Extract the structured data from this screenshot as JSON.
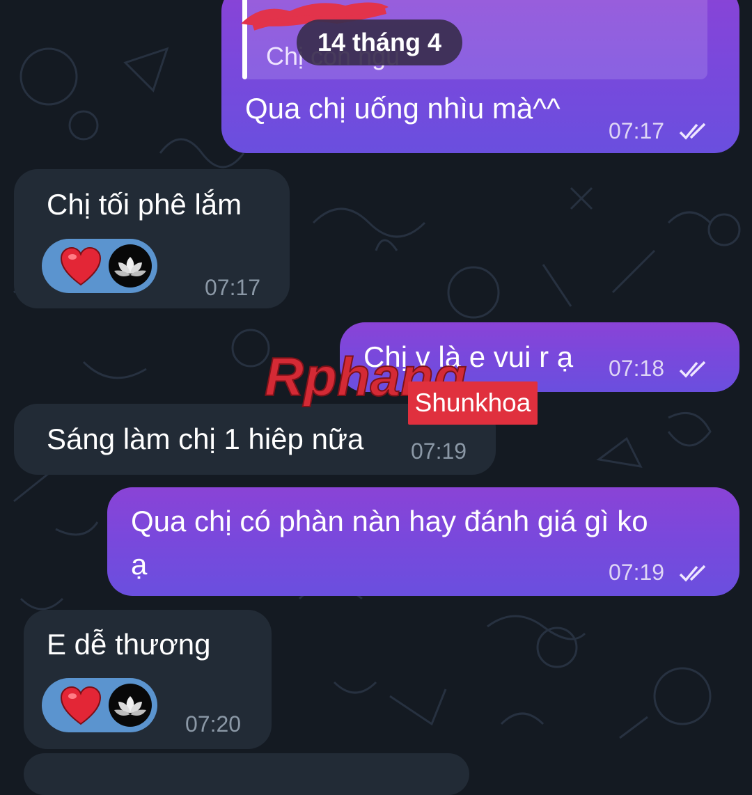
{
  "date_separator": "14 tháng 4",
  "reply_preview": {
    "text": "Chị còn ngủ"
  },
  "messages": [
    {
      "id": "m1",
      "direction": "outgoing",
      "text": "Qua chị uống nhìu mà^^",
      "time": "07:17",
      "status": "read"
    },
    {
      "id": "m2",
      "direction": "incoming",
      "text": "Chị tối phê lắm",
      "time": "07:17",
      "reactions": [
        "heart-icon",
        "lotus-avatar"
      ]
    },
    {
      "id": "m3",
      "direction": "outgoing",
      "text": "Chị v là e vui r ạ",
      "time": "07:18",
      "status": "read"
    },
    {
      "id": "m4",
      "direction": "incoming",
      "text": "Sáng làm chị 1 hiêp nữa",
      "time": "07:19"
    },
    {
      "id": "m5",
      "direction": "outgoing",
      "text_line1": "Qua chị có phàn nàn hay đánh giá gì ko",
      "text_line2": "ạ",
      "time": "07:19",
      "status": "read"
    },
    {
      "id": "m6",
      "direction": "incoming",
      "text": "E dễ thương",
      "time": "07:20",
      "reactions": [
        "heart-icon",
        "lotus-avatar"
      ]
    }
  ],
  "watermark": {
    "logo": "Rphang",
    "tag": "Shunkhoa"
  },
  "colors": {
    "outgoing": "#7a48dc",
    "incoming": "#222b36",
    "background": "#141a22",
    "reaction": "#5b94cf",
    "watermark_red": "#e0303e"
  }
}
